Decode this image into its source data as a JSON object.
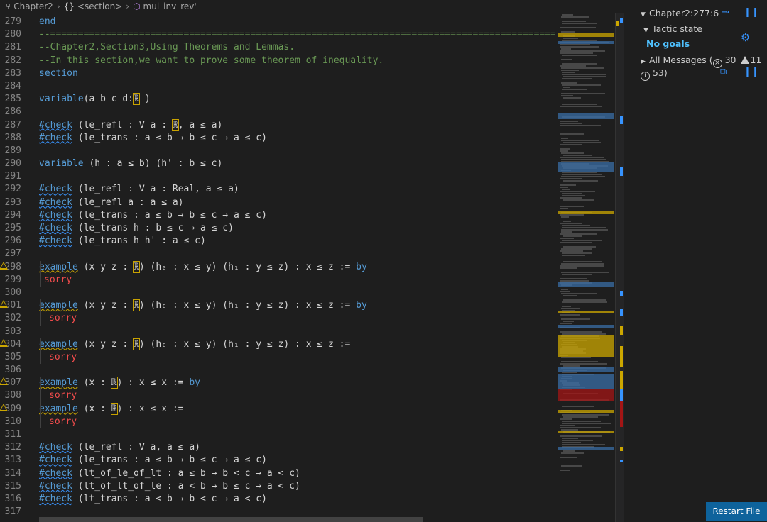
{
  "breadcrumb": {
    "file": "Chapter2",
    "section": "<section>",
    "symbol": "mul_inv_rev'"
  },
  "code": {
    "lines": [
      {
        "n": "279",
        "t": "end"
      },
      {
        "n": "280",
        "t": "--============================================================================================"
      },
      {
        "n": "281",
        "t": "--Chapter2,Section3,Using Theorems and Lemmas."
      },
      {
        "n": "282",
        "t": "--In this section,we want to prove some theorem of inequality."
      },
      {
        "n": "283",
        "t": "section"
      },
      {
        "n": "284",
        "t": ""
      },
      {
        "n": "285",
        "t": "variable(a b c d:ℝ )"
      },
      {
        "n": "286",
        "t": ""
      },
      {
        "n": "287",
        "t": "#check (le_refl : ∀ a : ℝ, a ≤ a)"
      },
      {
        "n": "288",
        "t": "#check (le_trans : a ≤ b → b ≤ c → a ≤ c)"
      },
      {
        "n": "289",
        "t": ""
      },
      {
        "n": "290",
        "t": "variable (h : a ≤ b) (h' : b ≤ c)"
      },
      {
        "n": "291",
        "t": ""
      },
      {
        "n": "292",
        "t": "#check (le_refl : ∀ a : Real, a ≤ a)"
      },
      {
        "n": "293",
        "t": "#check (le_refl a : a ≤ a)"
      },
      {
        "n": "294",
        "t": "#check (le_trans : a ≤ b → b ≤ c → a ≤ c)"
      },
      {
        "n": "295",
        "t": "#check (le_trans h : b ≤ c → a ≤ c)"
      },
      {
        "n": "296",
        "t": "#check (le_trans h h' : a ≤ c)"
      },
      {
        "n": "297",
        "t": ""
      },
      {
        "n": "298",
        "t": "example (x y z : ℝ) (h₀ : x ≤ y) (h₁ : y ≤ z) : x ≤ z := by"
      },
      {
        "n": "299",
        "t": " sorry"
      },
      {
        "n": "300",
        "t": ""
      },
      {
        "n": "301",
        "t": "example (x y z : ℝ) (h₀ : x ≤ y) (h₁ : y ≤ z) : x ≤ z := by"
      },
      {
        "n": "302",
        "t": "  sorry"
      },
      {
        "n": "303",
        "t": ""
      },
      {
        "n": "304",
        "t": "example (x y z : ℝ) (h₀ : x ≤ y) (h₁ : y ≤ z) : x ≤ z :="
      },
      {
        "n": "305",
        "t": "  sorry"
      },
      {
        "n": "306",
        "t": ""
      },
      {
        "n": "307",
        "t": "example (x : ℝ) : x ≤ x := by"
      },
      {
        "n": "308",
        "t": "  sorry"
      },
      {
        "n": "309",
        "t": "example (x : ℝ) : x ≤ x :="
      },
      {
        "n": "310",
        "t": "  sorry"
      },
      {
        "n": "311",
        "t": ""
      },
      {
        "n": "312",
        "t": "#check (le_refl : ∀ a, a ≤ a)"
      },
      {
        "n": "313",
        "t": "#check (le_trans : a ≤ b → b ≤ c → a ≤ c)"
      },
      {
        "n": "314",
        "t": "#check (lt_of_le_of_lt : a ≤ b → b < c → a < c)"
      },
      {
        "n": "315",
        "t": "#check (lt_of_lt_of_le : a < b → b ≤ c → a < c)"
      },
      {
        "n": "316",
        "t": "#check (lt_trans : a < b → b < c → a < c)"
      },
      {
        "n": "317",
        "t": ""
      }
    ]
  },
  "infoview": {
    "position": "Chapter2:277:6",
    "tactic_state_label": "Tactic state",
    "no_goals": "No goals",
    "all_messages_label": "All Messages (",
    "errors": "30",
    "warnings": "11",
    "info": "53)",
    "restart_label": "Restart File"
  },
  "colors": {
    "keyword": "#569cd6",
    "comment": "#6a9955",
    "sorry": "#f14c4c",
    "warning": "#cca700",
    "accent": "#3794ff",
    "button": "#0e639c"
  }
}
